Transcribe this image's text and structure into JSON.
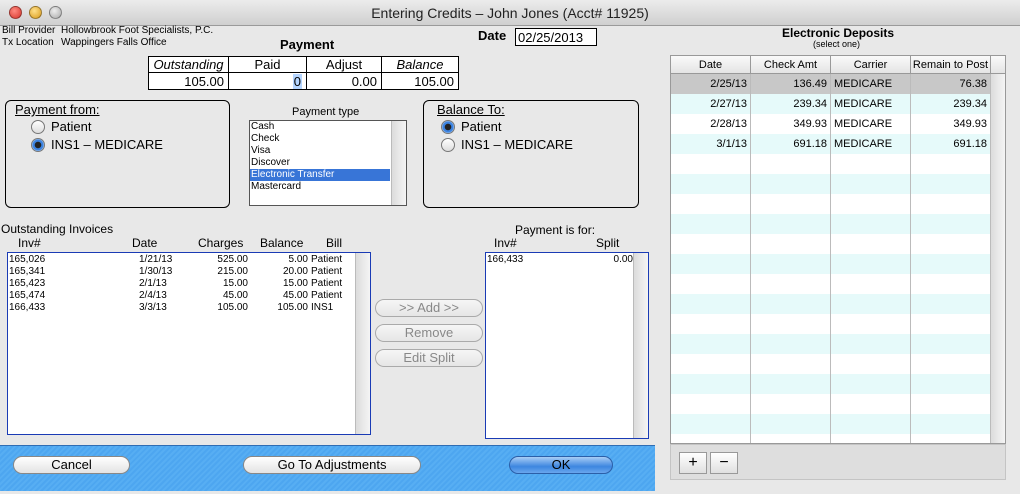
{
  "window": {
    "title": "Entering Credits – John Jones (Acct# 11925)"
  },
  "header": {
    "bill_provider_label": "Bill Provider",
    "bill_provider_value": "Hollowbrook Foot Specialists, P.C.",
    "tx_location_label": "Tx Location",
    "tx_location_value": "Wappingers Falls Office",
    "payment_heading": "Payment",
    "date_label": "Date",
    "date_value": "02/25/2013"
  },
  "payment_table": {
    "headers": [
      "Outstanding",
      "Paid",
      "Adjust",
      "Balance"
    ],
    "outstanding": "105.00",
    "paid": "0",
    "adjust": "0.00",
    "balance": "105.00"
  },
  "payment_from": {
    "title": "Payment from:",
    "options": [
      "Patient",
      "INS1 – MEDICARE"
    ],
    "selected": 1
  },
  "payment_type": {
    "title": "Payment type",
    "options": [
      "Cash",
      "Check",
      "Visa",
      "Discover",
      "Electronic Transfer",
      "Mastercard"
    ],
    "selected": 4
  },
  "balance_to": {
    "title": "Balance To:",
    "options": [
      "Patient",
      "INS1 – MEDICARE"
    ],
    "selected": 0
  },
  "outstanding_invoices": {
    "title": "Outstanding Invoices",
    "headers": [
      "Inv#",
      "Date",
      "Charges",
      "Balance",
      "Bill"
    ],
    "rows": [
      [
        "165,026",
        "1/21/13",
        "525.00",
        "5.00",
        "Patient"
      ],
      [
        "165,341",
        "1/30/13",
        "215.00",
        "20.00",
        "Patient"
      ],
      [
        "165,423",
        "2/1/13",
        "15.00",
        "15.00",
        "Patient"
      ],
      [
        "165,474",
        "2/4/13",
        "45.00",
        "45.00",
        "Patient"
      ],
      [
        "166,433",
        "3/3/13",
        "105.00",
        "105.00",
        "INS1"
      ]
    ]
  },
  "actions": {
    "add": ">> Add >>",
    "remove": "Remove",
    "edit_split": "Edit Split"
  },
  "payment_is_for": {
    "title": "Payment is for:",
    "headers": [
      "Inv#",
      "Split"
    ],
    "rows": [
      [
        "166,433",
        "0.00"
      ]
    ]
  },
  "electronic_deposits": {
    "title": "Electronic Deposits",
    "subtitle": "(select one)",
    "headers": [
      "Date",
      "Check Amt",
      "Carrier",
      "Remain to Post"
    ],
    "rows": [
      [
        "2/25/13",
        "136.49",
        "MEDICARE",
        "76.38"
      ],
      [
        "2/27/13",
        "239.34",
        "MEDICARE",
        "239.34"
      ],
      [
        "2/28/13",
        "349.93",
        "MEDICARE",
        "349.93"
      ],
      [
        "3/1/13",
        "691.18",
        "MEDICARE",
        "691.18"
      ]
    ],
    "selected_row": 0,
    "add_symbol": "+",
    "remove_symbol": "−"
  },
  "footer": {
    "cancel": "Cancel",
    "go_to_adjustments": "Go To Adjustments",
    "ok": "OK"
  },
  "colors": {
    "selection": "#3875d7",
    "row_alt": "#e6fafa",
    "row_selected": "#c8c8c8",
    "bottom_bar": "#4da6f0"
  }
}
